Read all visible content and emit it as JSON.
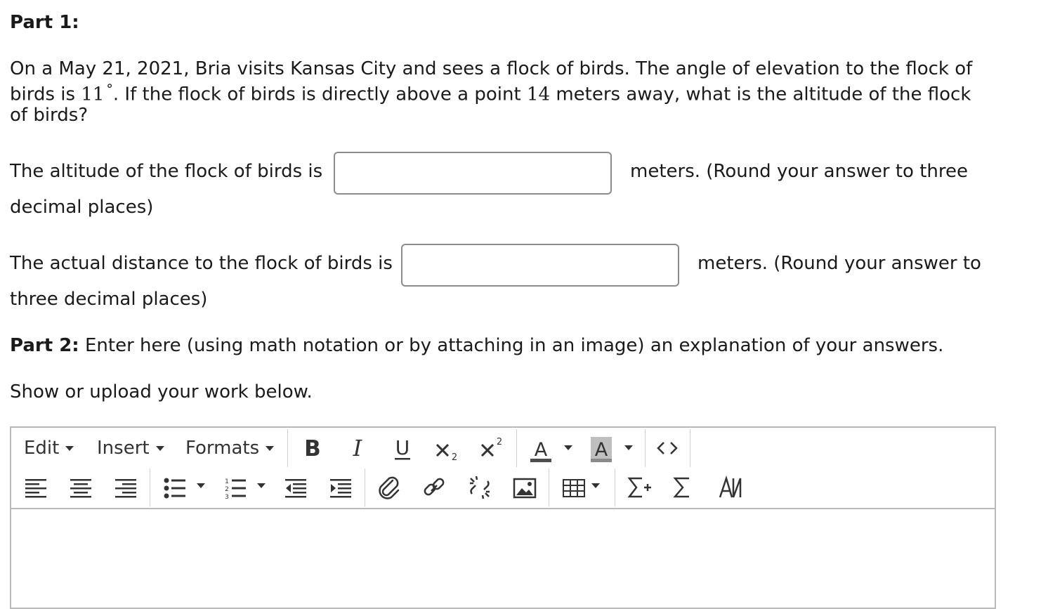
{
  "part1": {
    "heading": "Part 1:",
    "problem_line1": "On a May 21, 2021, Bria visits Kansas City and sees a flock of birds. The angle of elevation to the flock of",
    "problem_line2_a": "birds is ",
    "angle_value": "11",
    "angle_unit": "°",
    "problem_line2_b": ". If the flock of birds is directly above a point ",
    "distance_value": "14",
    "problem_line2_c": " meters away, what is the altitude of the flock",
    "problem_line3": "of birds?"
  },
  "question1": {
    "prefix": "The altitude of the flock of birds is",
    "suffix_line1": "meters. (Round your answer to three",
    "suffix_line2": "decimal places)",
    "value": ""
  },
  "question2": {
    "prefix": "The actual distance to the flock of birds is",
    "suffix_line1": "meters. (Round your answer to",
    "suffix_line2": "three decimal places)",
    "value": ""
  },
  "part2": {
    "heading": "Part 2:",
    "text": " Enter here (using math notation or by attaching in an image) an explanation of your answers.",
    "instruction": "Show or upload your work below."
  },
  "editor": {
    "menus": {
      "edit": "Edit",
      "insert": "Insert",
      "formats": "Formats"
    },
    "icons": [
      "bold-icon",
      "italic-icon",
      "underline-icon",
      "subscript-icon",
      "superscript-icon",
      "text-color-icon",
      "background-color-icon",
      "source-code-icon",
      "align-left-icon",
      "align-center-icon",
      "align-right-icon",
      "bullet-list-icon",
      "numbered-list-icon",
      "outdent-icon",
      "indent-icon",
      "attachment-icon",
      "link-icon",
      "unlink-icon",
      "image-icon",
      "table-icon",
      "insert-equation-icon",
      "sigma-icon",
      "special-characters-icon"
    ],
    "content": ""
  }
}
